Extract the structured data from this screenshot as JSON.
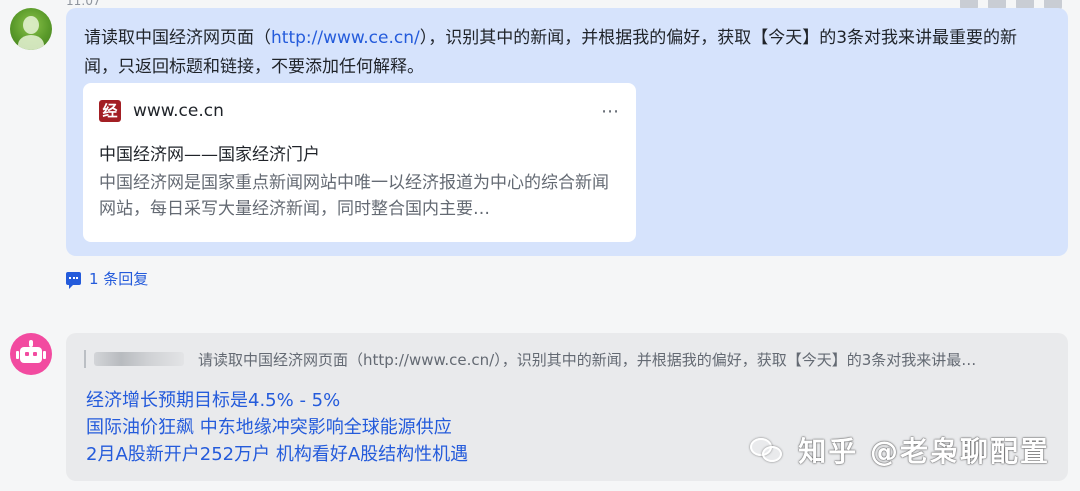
{
  "message": {
    "timestamp": "11:07",
    "text_before_link": "请读取中国经济网页面（",
    "link": "http://www.ce.cn/",
    "text_after_link": "），识别其中的新闻，并根据我的偏好，获取【今天】的3条对我来讲最重要的新闻，只返回标题和链接，不要添加任何解释。",
    "card": {
      "domain": "www.ce.cn",
      "site_icon_char": "经",
      "more_icon": "⋯",
      "title": "中国经济网——国家经济门户",
      "description": "中国经济网是国家重点新闻网站中唯一以经济报道为中心的综合新闻网站，每日采写大量经济新闻，同时整合国内主要…"
    }
  },
  "replies": {
    "label": "1 条回复"
  },
  "bot_reply": {
    "quote": "请读取中国经济网页面（http://www.ce.cn/），识别其中的新闻，并根据我的偏好，获取【今天】的3条对我来讲最…",
    "answers": [
      "经济增长预期目标是4.5% - 5%",
      "国际油价狂飙 中东地缘冲突影响全球能源供应",
      "2月A股新开户252万户 机构看好A股结构性机遇"
    ]
  },
  "watermark": {
    "text": "知乎 @老枭聊配置"
  },
  "colors": {
    "user_bubble": "#d6e3fc",
    "bot_bubble": "#e9eaec",
    "link": "#245bdb",
    "bot_avatar": "#f24ba0"
  }
}
